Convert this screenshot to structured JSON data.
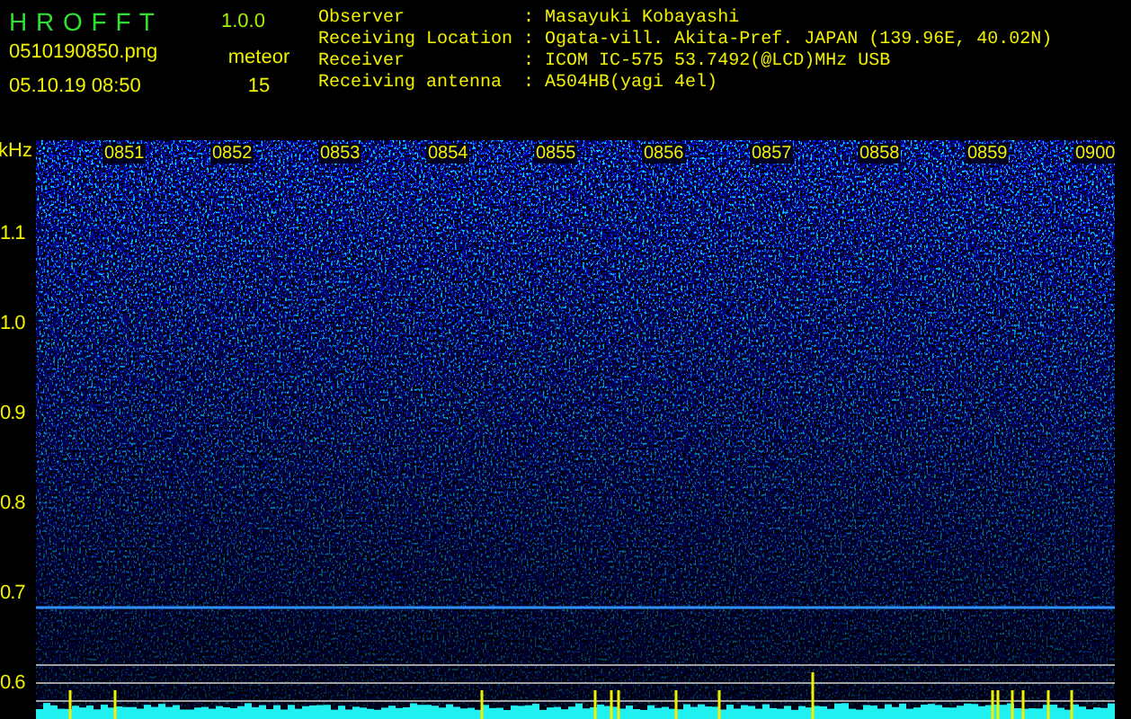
{
  "app": {
    "name": "H R O F F T",
    "version": "1.0.0"
  },
  "file": "0510190850.png",
  "datetime": "05.10.19 08:50",
  "meteor": {
    "label": "meteor",
    "count": "15"
  },
  "info": [
    {
      "label": "Observer",
      "separator": ":",
      "value": "Masayuki Kobayashi"
    },
    {
      "label": "Receiving Location",
      "separator": ":",
      "value": "Ogata-vill. Akita-Pref. JAPAN (139.96E, 40.02N)"
    },
    {
      "label": "Receiver",
      "separator": ":",
      "value": "ICOM IC-575 53.7492(@LCD)MHz USB"
    },
    {
      "label": "Receiving antenna",
      "separator": ":",
      "value": "A504HB(yagi 4el)"
    }
  ],
  "axis": {
    "unit": "kHz",
    "frequencies": [
      "1.1",
      "1.0",
      "0.9",
      "0.8",
      "0.7",
      "0.6"
    ],
    "times": [
      "0851",
      "0852",
      "0853",
      "0854",
      "0855",
      "0856",
      "0857",
      "0858",
      "0859",
      "0900"
    ]
  }
}
